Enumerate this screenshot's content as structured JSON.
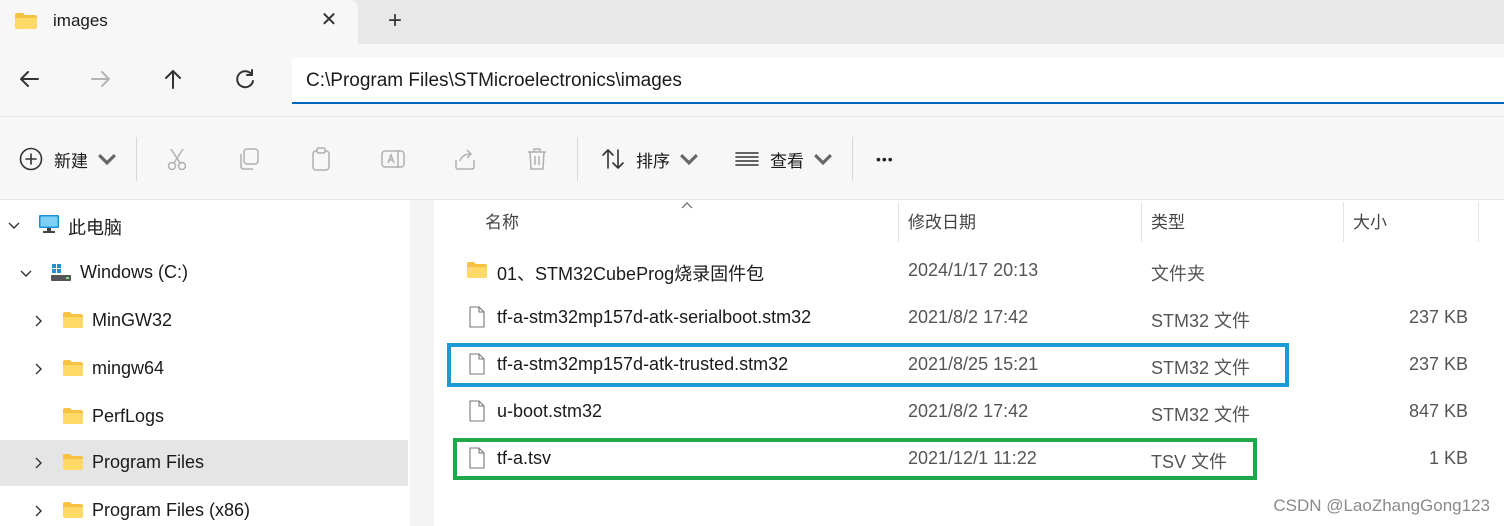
{
  "window": {
    "tab_title": "images",
    "tab_close_glyph": "✕",
    "new_tab_glyph": "+"
  },
  "address": {
    "path": "C:\\Program Files\\STMicroelectronics\\images"
  },
  "commands": {
    "new_label": "新建",
    "sort_label": "排序",
    "view_label": "查看",
    "more_glyph": "•••"
  },
  "sidebar": {
    "items": [
      {
        "label": "此电脑",
        "icon": "monitor-icon",
        "expand": "expanded"
      },
      {
        "label": "Windows (C:)",
        "icon": "drive-icon",
        "expand": "expanded"
      },
      {
        "label": "MinGW32",
        "icon": "folder-icon",
        "expand": "collapsed"
      },
      {
        "label": "mingw64",
        "icon": "folder-icon",
        "expand": "collapsed"
      },
      {
        "label": "PerfLogs",
        "icon": "folder-icon",
        "expand": "none"
      },
      {
        "label": "Program Files",
        "icon": "folder-icon",
        "expand": "collapsed",
        "selected": true
      },
      {
        "label": "Program Files (x86)",
        "icon": "folder-icon",
        "expand": "collapsed"
      }
    ]
  },
  "columns": {
    "name": "名称",
    "modified": "修改日期",
    "type": "类型",
    "size": "大小"
  },
  "files": [
    {
      "name": "01、STM32CubeProg烧录固件包",
      "date": "2024/1/17 20:13",
      "type": "文件夹",
      "size": "",
      "icon": "folder-icon"
    },
    {
      "name": "tf-a-stm32mp157d-atk-serialboot.stm32",
      "date": "2021/8/2 17:42",
      "type": "STM32 文件",
      "size": "237 KB",
      "icon": "file-icon"
    },
    {
      "name": "tf-a-stm32mp157d-atk-trusted.stm32",
      "date": "2021/8/25 15:21",
      "type": "STM32 文件",
      "size": "237 KB",
      "icon": "file-icon"
    },
    {
      "name": "u-boot.stm32",
      "date": "2021/8/2 17:42",
      "type": "STM32 文件",
      "size": "847 KB",
      "icon": "file-icon"
    },
    {
      "name": "tf-a.tsv",
      "date": "2021/12/1 11:22",
      "type": "TSV 文件",
      "size": "1 KB",
      "icon": "file-icon"
    }
  ],
  "highlights": {
    "blue": "#1c9ad6",
    "green": "#1ea84a"
  },
  "watermark": "CSDN @LaoZhangGong123"
}
